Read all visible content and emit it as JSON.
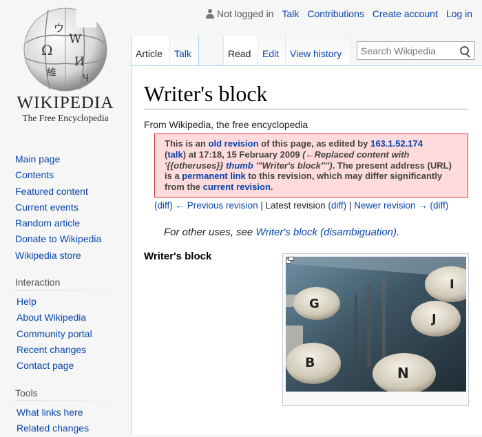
{
  "logo": {
    "wordmark": "WIKIPEDIA",
    "tagline": "The Free Encyclopedia",
    "glyphs": [
      "Ω",
      "W",
      "И",
      "維",
      "ウ",
      "Ч"
    ]
  },
  "personal": {
    "not_logged_in": "Not logged in",
    "links": [
      "Talk",
      "Contributions",
      "Create account",
      "Log in"
    ]
  },
  "tabs": {
    "left": [
      "Article",
      "Talk"
    ],
    "right": [
      "Read",
      "Edit",
      "View history"
    ]
  },
  "search": {
    "placeholder": "Search Wikipedia"
  },
  "sidebar": {
    "nav": [
      "Main page",
      "Contents",
      "Featured content",
      "Current events",
      "Random article",
      "Donate to Wikipedia",
      "Wikipedia store"
    ],
    "interaction_heading": "Interaction",
    "interaction": [
      "Help",
      "About Wikipedia",
      "Community portal",
      "Recent changes",
      "Contact page"
    ],
    "tools_heading": "Tools",
    "tools": [
      "What links here",
      "Related changes"
    ]
  },
  "article": {
    "title": "Writer's block",
    "tagline": "From Wikipedia, the free encyclopedia",
    "revision": {
      "t1": "This is an ",
      "old_revision": "old revision",
      "t2": " of this page, as edited by ",
      "ip": "163.1.52.174",
      "t3": " (",
      "talk": "talk",
      "t4": ") at 17:18, 15 February 2009 ",
      "summary1": "(←Replaced content with '{{otheruses}} ",
      "thumb": "thumb",
      "summary2": " '\"Writer's block\"'')",
      "t5": ". The present address (URL) is a ",
      "permanent_link": "permanent link",
      "t6": " to this revision, which may differ significantly from the ",
      "current_revision": "current revision",
      "t7": "."
    },
    "revnav": {
      "diff1": "(diff)",
      "previous": "← Previous revision",
      "sep1": " | ",
      "latest": "Latest revision",
      "diff2": "(diff)",
      "sep2": " | ",
      "newer": "Newer revision →",
      "diff3": "(diff)"
    },
    "hatnote": {
      "prefix": "For other uses, see ",
      "link": "Writer's block (disambiguation)",
      "suffix": "."
    },
    "infobox_title": "Writer's block",
    "image_keys": [
      "G",
      "I",
      "J",
      "B",
      "N"
    ]
  },
  "colors": {
    "link": "#0645ad",
    "revbox_bg": "#ffdbdb",
    "revbox_border": "#dd3333",
    "content_border": "#a7d7f9"
  }
}
